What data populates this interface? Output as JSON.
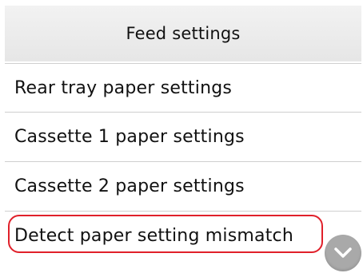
{
  "header": {
    "title": "Feed settings"
  },
  "menu": {
    "items": [
      {
        "label": "Rear tray paper settings"
      },
      {
        "label": "Cassette 1 paper settings"
      },
      {
        "label": "Cassette 2 paper settings"
      },
      {
        "label": "Detect paper setting mismatch",
        "highlighted": true
      }
    ]
  },
  "scroll": {
    "icon": "chevron-down-icon",
    "color": "#a9a9a9"
  },
  "colors": {
    "highlight": "#e0202a",
    "header_bg": "#ececec"
  }
}
